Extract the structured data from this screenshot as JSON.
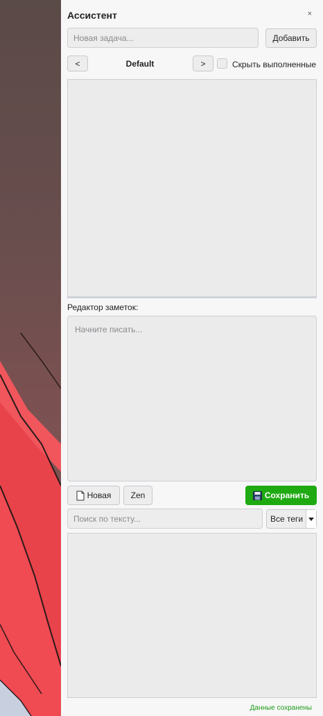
{
  "panel": {
    "title": "Ассистент",
    "close_label": "×"
  },
  "task": {
    "placeholder": "Новая задача...",
    "add_label": "Добавить"
  },
  "list_nav": {
    "prev_label": "<",
    "list_name": "Default",
    "next_label": ">",
    "hide_done_label": "Скрыть выполненные",
    "hide_done_checked": false
  },
  "notes": {
    "editor_label": "Редактор заметок:",
    "placeholder": "Начните писать...",
    "new_label": "Новая",
    "zen_label": "Zen",
    "save_label": "Сохранить"
  },
  "search": {
    "placeholder": "Поиск по тексту...",
    "tags_selected": "Все теги"
  },
  "status": {
    "text": "Данные сохранены"
  },
  "colors": {
    "save_green": "#1faa12",
    "status_green": "#1e9c16",
    "panel_bg": "#f7f7f8"
  }
}
